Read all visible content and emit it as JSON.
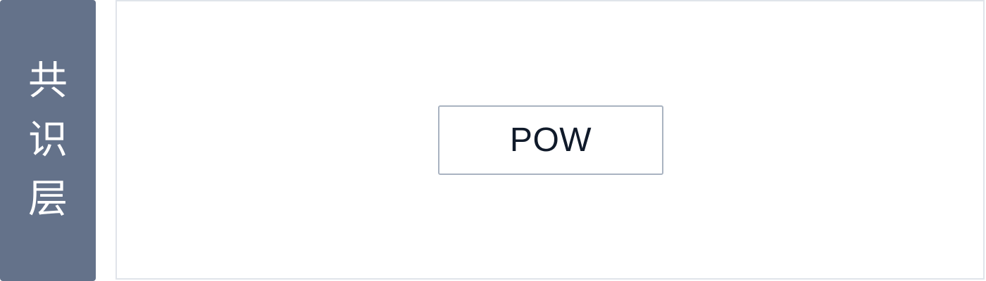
{
  "layer": {
    "label_chars": [
      "共",
      "识",
      "层"
    ],
    "label_bg_color": "#64728a",
    "label_text_color": "#ffffff",
    "panel_border_color": "#e0e4ea"
  },
  "nodes": [
    {
      "label": "POW",
      "border_color": "#a9b3c1",
      "text_color": "#101a2a"
    }
  ]
}
